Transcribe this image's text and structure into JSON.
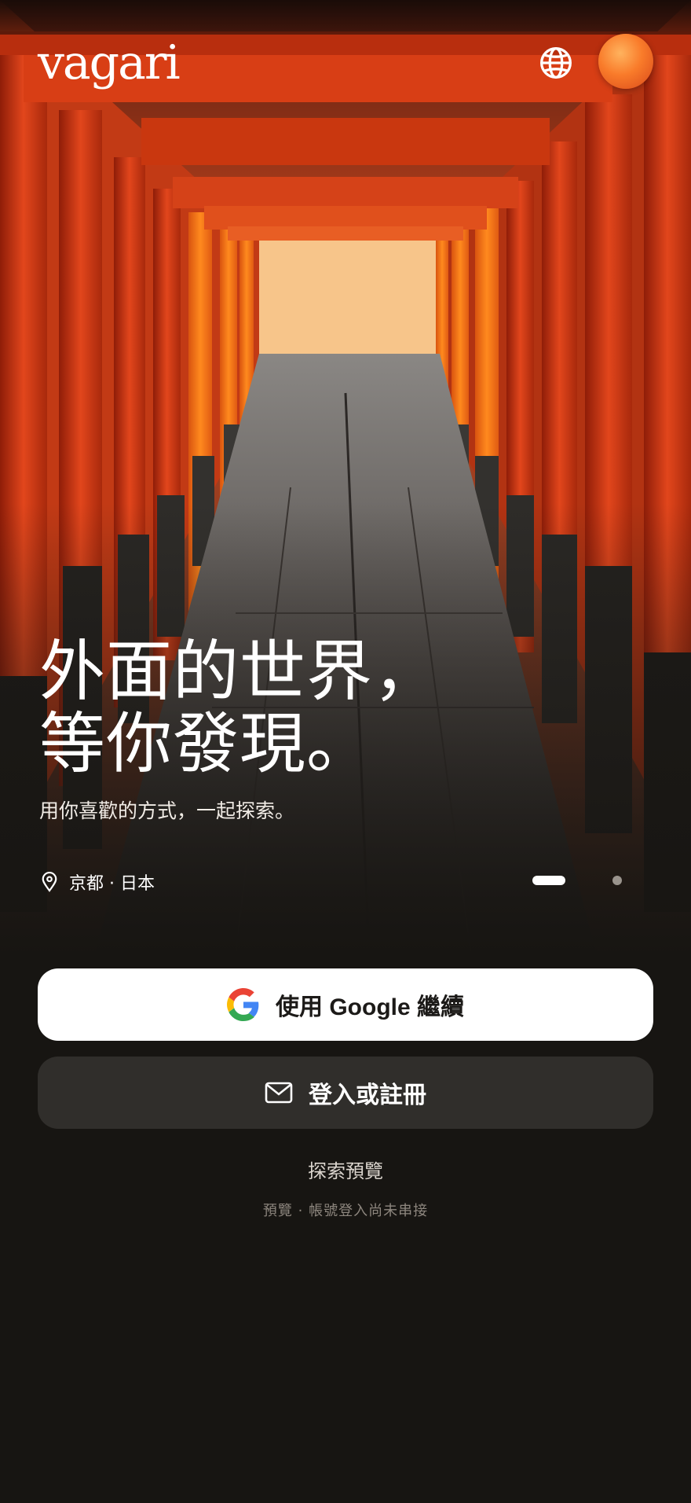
{
  "brand": {
    "logo_text": "vagari"
  },
  "header": {
    "language_icon": "globe-icon",
    "avatar_icon": "user-avatar"
  },
  "hero": {
    "headline_line1": "外面的世界，",
    "headline_line2": "等你發現。",
    "subtitle": "用你喜歡的方式，一起探索。",
    "location_icon": "map-pin-icon",
    "location": "京都 · 日本",
    "carousel": {
      "slides": 2,
      "active_index": 0
    }
  },
  "actions": {
    "google_button": "使用 Google 繼續",
    "email_button": "登入或註冊",
    "email_icon": "mail-icon",
    "explore_link": "探索預覽",
    "preview_note": "預覽 · 帳號登入尚未串接"
  },
  "colors": {
    "background": "#171512",
    "torii_orange": "#e2461c",
    "secondary_button": "#302e2b",
    "primary_button": "#ffffff",
    "avatar": "#f97b2a"
  }
}
